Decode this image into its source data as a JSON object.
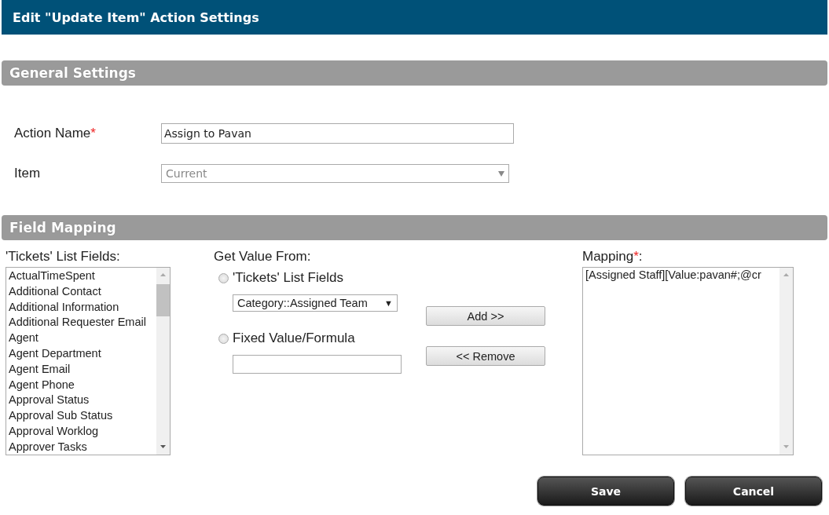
{
  "window": {
    "title": "Edit \"Update Item\" Action Settings"
  },
  "general_settings": {
    "title": "General Settings",
    "action_name": {
      "label": "Action Name",
      "required_mark": "*",
      "value": "Assign to Pavan"
    },
    "item": {
      "label": "Item",
      "value": "Current",
      "disabled": true
    }
  },
  "field_mapping": {
    "title": "Field Mapping",
    "list_fields": {
      "label": "'Tickets' List Fields:",
      "items": [
        {
          "text": "ActualTimeSpent",
          "selected": false
        },
        {
          "text": "Additional Contact",
          "selected": false
        },
        {
          "text": "Additional Information",
          "selected": false
        },
        {
          "text": "Additional Requester Email",
          "selected": false
        },
        {
          "text": "Agent",
          "selected": false
        },
        {
          "text": "Agent Department",
          "selected": false
        },
        {
          "text": "Agent Email",
          "selected": false
        },
        {
          "text": "Agent Phone",
          "selected": false
        },
        {
          "text": "Approval Status",
          "selected": false
        },
        {
          "text": "Approval Sub Status",
          "selected": false
        },
        {
          "text": "Approval Worklog",
          "selected": false
        },
        {
          "text": "Approver Tasks",
          "selected": false
        }
      ]
    },
    "get_value_from": {
      "label": "Get Value From:",
      "options": [
        {
          "label": "'Tickets' List Fields",
          "selected": false,
          "kind": "dropdown",
          "value": "Category::Assigned Team",
          "caret": "▼"
        },
        {
          "label": "Fixed Value/Formula",
          "selected": false,
          "kind": "text"
        }
      ]
    },
    "buttons": [
      "Add >>",
      "<< Remove"
    ],
    "mapping": {
      "label": "Mapping",
      "required_mark": "*",
      "label_suffix": ":",
      "value": "[Assigned Staff][Value:pavan#;@cr"
    }
  },
  "footer_buttons": [
    "Save",
    "Cancel"
  ]
}
